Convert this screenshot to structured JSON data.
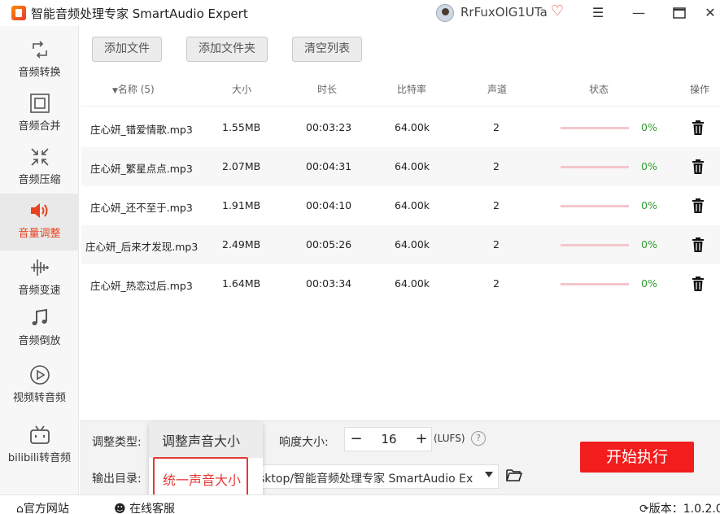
{
  "titlebar": {
    "app_title": "智能音频处理专家 SmartAudio Expert",
    "user_name": "RrFuxOlG1UTa"
  },
  "sidebar": {
    "items": [
      {
        "label": "音频转换",
        "icon": "convert-icon"
      },
      {
        "label": "音频合并",
        "icon": "merge-icon"
      },
      {
        "label": "音频压缩",
        "icon": "compress-icon"
      },
      {
        "label": "音量调整",
        "icon": "speaker-icon",
        "active": true
      },
      {
        "label": "音频变速",
        "icon": "waveform-icon"
      },
      {
        "label": "音频倒放",
        "icon": "music-note-icon"
      },
      {
        "label": "视频转音频",
        "icon": "play-icon"
      },
      {
        "label": "bilibili转音频",
        "icon": "bilibili-icon"
      }
    ]
  },
  "toolbar": {
    "add_file": "添加文件",
    "add_folder": "添加文件夹",
    "clear_list": "清空列表"
  },
  "table": {
    "headers": {
      "name": "名称 (5)",
      "size": "大小",
      "duration": "时长",
      "bitrate": "比特率",
      "channels": "声道",
      "status": "状态",
      "action": "操作"
    },
    "rows": [
      {
        "name": "庄心妍_错爱情歌.mp3",
        "size": "1.55MB",
        "duration": "00:03:23",
        "bitrate": "64.00k",
        "channels": "2",
        "progress": "0%"
      },
      {
        "name": "庄心妍_繁星点点.mp3",
        "size": "2.07MB",
        "duration": "00:04:31",
        "bitrate": "64.00k",
        "channels": "2",
        "progress": "0%"
      },
      {
        "name": "庄心妍_还不至于.mp3",
        "size": "1.91MB",
        "duration": "00:04:10",
        "bitrate": "64.00k",
        "channels": "2",
        "progress": "0%"
      },
      {
        "name": "庄心妍_后来才发现.mp3",
        "size": "2.49MB",
        "duration": "00:05:26",
        "bitrate": "64.00k",
        "channels": "2",
        "progress": "0%"
      },
      {
        "name": "庄心妍_热恋过后.mp3",
        "size": "1.64MB",
        "duration": "00:03:34",
        "bitrate": "64.00k",
        "channels": "2",
        "progress": "0%"
      }
    ]
  },
  "settings": {
    "adjust_type_label": "调整类型:",
    "dropdown_options": [
      "调整声音大小",
      "统一声音大小"
    ],
    "loudness_label": "响度大小:",
    "loudness_value": "16",
    "loudness_unit": "(LUFS)",
    "output_label": "输出目录:",
    "output_path": "sktop/智能音频处理专家 SmartAudio Ex",
    "start_button": "开始执行"
  },
  "statusbar": {
    "website": "官方网站",
    "support": "在线客服",
    "version": "版本：1.0.2.0"
  },
  "colors": {
    "accent": "#e8431f",
    "start_button": "#f21d1d",
    "progress_text": "#2e9e2e"
  }
}
